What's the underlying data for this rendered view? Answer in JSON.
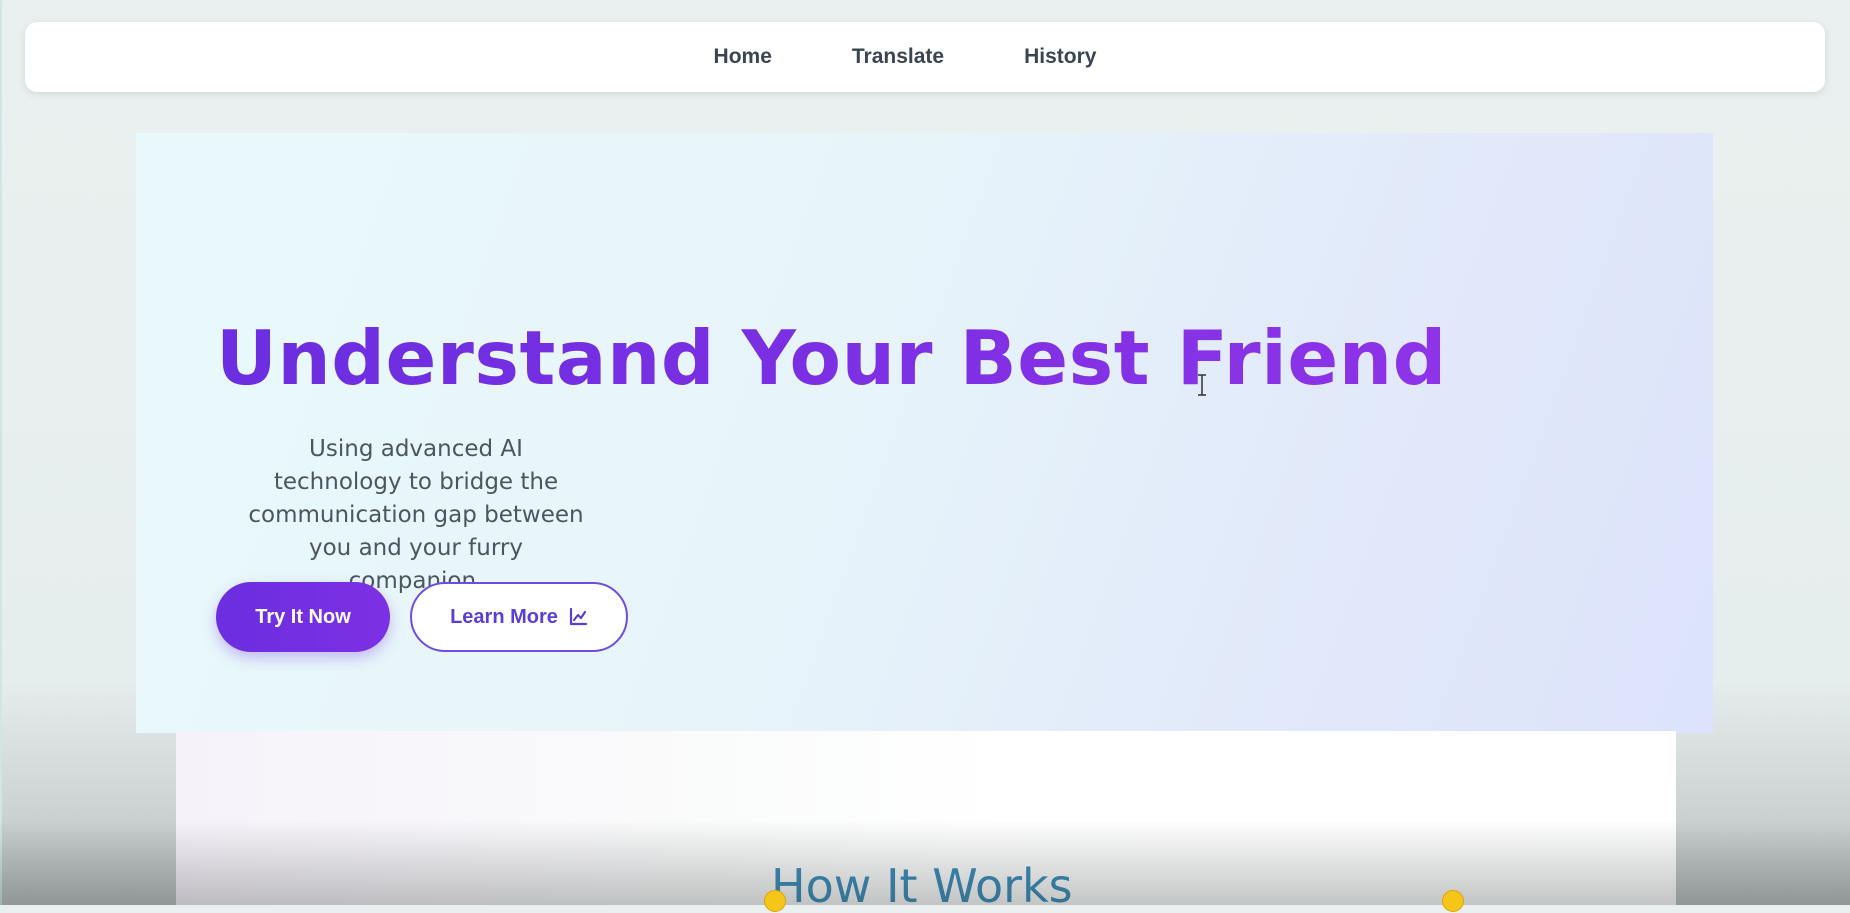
{
  "nav": {
    "items": [
      {
        "label": "Home"
      },
      {
        "label": "Translate"
      },
      {
        "label": "History"
      }
    ]
  },
  "hero": {
    "title": "Understand Your Best Friend",
    "subtitle": "Using advanced AI technology to bridge the communication gap between you and your furry companion.",
    "primary_button": "Try It Now",
    "secondary_button": "Learn More",
    "secondary_button_icon": "chart-line-icon",
    "accent_color": "#6b2ee0"
  },
  "features": {
    "title": "How It Works"
  }
}
